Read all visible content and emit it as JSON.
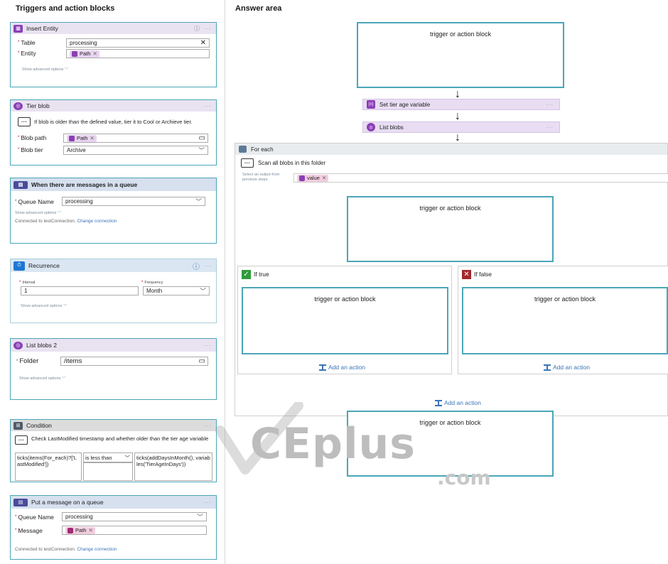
{
  "left": {
    "title": "Triggers and action blocks",
    "insert_entity": {
      "title": "Insert Entity",
      "table_label": "Table",
      "table_value": "processing",
      "entity_label": "Entity",
      "entity_token": "Path",
      "show_advanced": "Show advanced options"
    },
    "tier_blob": {
      "title": "Tier blob",
      "comment": "If blob is older than the defined value, tier it to Cool or Archieve tier.",
      "path_label": "Blob path",
      "path_token": "Path",
      "tier_label": "Blob tier",
      "tier_value": "Archive"
    },
    "queue_trigger": {
      "title": "When there are messages in a queue",
      "queue_label": "Queue Name",
      "queue_value": "processing",
      "show_advanced": "Show advanced options",
      "connected": "Connected to testConnection.",
      "change": "Change connection"
    },
    "recurrence": {
      "title": "Recurrence",
      "interval_label": "Interval",
      "interval_value": "1",
      "frequency_label": "Frequency",
      "frequency_value": "Month",
      "show_advanced": "Show advanced options"
    },
    "list_blobs2": {
      "title": "List blobs 2",
      "folder_label": "Folder",
      "folder_value": "/items",
      "show_advanced": "Show advanced options"
    },
    "condition": {
      "title": "Condition",
      "comment": "Check LastModified timestamp and whether older than the tier age variable",
      "left_value": "ticks(items(For_each)?['LastModified'])",
      "operator": "is less than",
      "right_value": "ticks(addDaysInMonth(), variables('TierAgeInDays'))"
    },
    "put_message": {
      "title": "Put a message on a queue",
      "queue_label": "Queue Name",
      "queue_value": "processing",
      "message_label": "Message",
      "message_token": "Path",
      "connected": "Connected to testConnection.",
      "change": "Change connection"
    }
  },
  "answer": {
    "title": "Answer area",
    "slot_label": "trigger or action block",
    "set_tier": "Set tier age variable",
    "list_blobs": "List blobs",
    "for_each": "For each",
    "scan_comment": "Scan all blobs in this folder",
    "select_output": "Select an output from previous steps",
    "value_token": "value",
    "if_true": "If true",
    "if_false": "If false",
    "add_action": "Add an action"
  },
  "watermark": {
    "main": "CEplus",
    "sub": ".com"
  },
  "colors": {
    "card_border": "#4aa6b8",
    "purple": "#8a3fb5",
    "link": "#3b74b8"
  }
}
